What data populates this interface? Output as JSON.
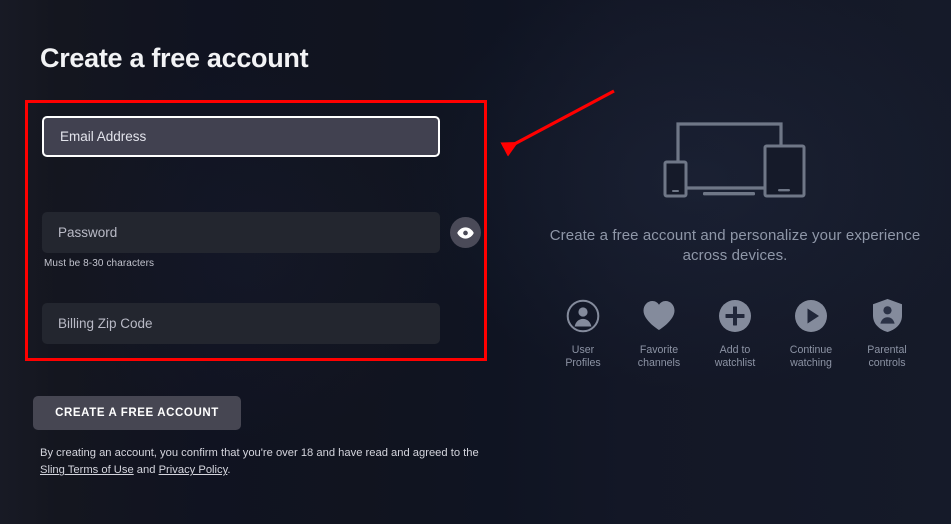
{
  "page": {
    "title": "Create a free account",
    "background_color": "#11141f"
  },
  "form": {
    "email": {
      "placeholder": "Email Address",
      "value": "",
      "focused": true
    },
    "password": {
      "placeholder": "Password",
      "value": "",
      "helper_text": "Must be 8-30 characters",
      "toggle_icon": "eye-icon"
    },
    "zip": {
      "placeholder": "Billing Zip Code",
      "value": ""
    },
    "submit_label": "CREATE A FREE ACCOUNT"
  },
  "legal": {
    "intro": "By creating an account, you confirm that you're over 18 and have read and agreed to the",
    "terms_link": "Sling Terms of Use",
    "conjunction": "and",
    "privacy_link": "Privacy Policy",
    "period": "."
  },
  "promo": {
    "illustration": "devices-illustration",
    "headline": "Create a free account and personalize your experience across devices.",
    "features": [
      {
        "icon": "user-profile-icon",
        "label": "User\nProfiles"
      },
      {
        "icon": "heart-icon",
        "label": "Favorite\nchannels"
      },
      {
        "icon": "plus-circle-icon",
        "label": "Add to\nwatchlist"
      },
      {
        "icon": "play-circle-icon",
        "label": "Continue\nwatching"
      },
      {
        "icon": "shield-person-icon",
        "label": "Parental\ncontrols"
      }
    ]
  },
  "annotations": {
    "highlight_color": "#ff0000",
    "box_label": "form-fields-highlight",
    "arrow_label": "pointer-arrow"
  }
}
